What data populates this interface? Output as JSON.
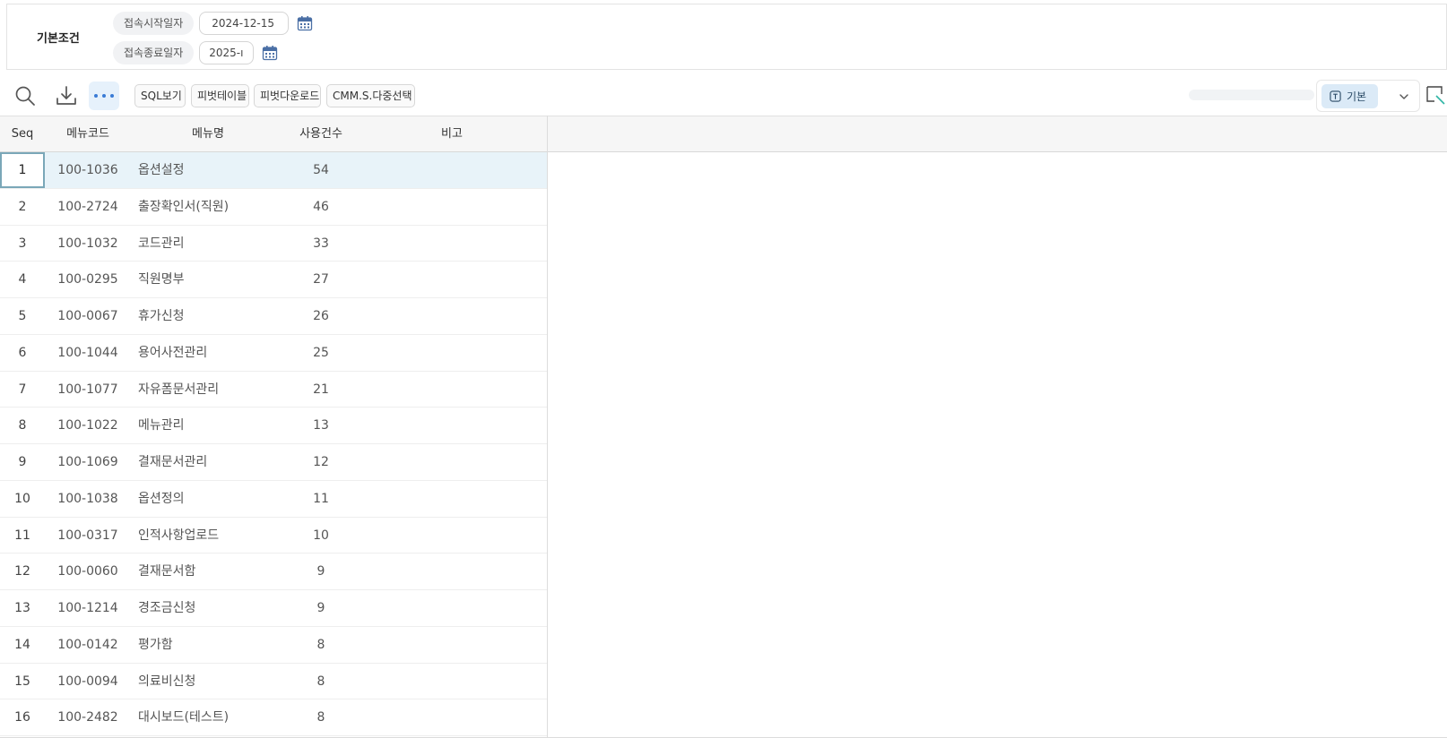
{
  "conditions": {
    "title": "기본조건",
    "start": {
      "label": "접속시작일자",
      "value": "2024-12-15"
    },
    "end": {
      "label": "접속종료일자",
      "value": "2025-ı"
    }
  },
  "toolbar": {
    "icons": [
      "search-icon",
      "download-icon",
      "more-icon"
    ],
    "buttons": [
      "SQL보기",
      "피벗테이블",
      "피벗다운로드",
      "CMM.S.다중선택"
    ],
    "view_label": "기본"
  },
  "grid": {
    "columns": [
      "Seq",
      "메뉴코드",
      "메뉴명",
      "사용건수",
      "비고"
    ],
    "selected_row": 0,
    "rows": [
      {
        "seq": "1",
        "code": "100-1036",
        "name": "옵션설정",
        "count": "54",
        "note": ""
      },
      {
        "seq": "2",
        "code": "100-2724",
        "name": "출장확인서(직원)",
        "count": "46",
        "note": ""
      },
      {
        "seq": "3",
        "code": "100-1032",
        "name": "코드관리",
        "count": "33",
        "note": ""
      },
      {
        "seq": "4",
        "code": "100-0295",
        "name": "직원명부",
        "count": "27",
        "note": ""
      },
      {
        "seq": "5",
        "code": "100-0067",
        "name": "휴가신청",
        "count": "26",
        "note": ""
      },
      {
        "seq": "6",
        "code": "100-1044",
        "name": "용어사전관리",
        "count": "25",
        "note": ""
      },
      {
        "seq": "7",
        "code": "100-1077",
        "name": "자유폼문서관리",
        "count": "21",
        "note": ""
      },
      {
        "seq": "8",
        "code": "100-1022",
        "name": "메뉴관리",
        "count": "13",
        "note": ""
      },
      {
        "seq": "9",
        "code": "100-1069",
        "name": "결재문서관리",
        "count": "12",
        "note": ""
      },
      {
        "seq": "10",
        "code": "100-1038",
        "name": "옵션정의",
        "count": "11",
        "note": ""
      },
      {
        "seq": "11",
        "code": "100-0317",
        "name": "인적사항업로드",
        "count": "10",
        "note": ""
      },
      {
        "seq": "12",
        "code": "100-0060",
        "name": "결재문서함",
        "count": "9",
        "note": ""
      },
      {
        "seq": "13",
        "code": "100-1214",
        "name": "경조금신청",
        "count": "9",
        "note": ""
      },
      {
        "seq": "14",
        "code": "100-0142",
        "name": "평가함",
        "count": "8",
        "note": ""
      },
      {
        "seq": "15",
        "code": "100-0094",
        "name": "의료비신청",
        "count": "8",
        "note": ""
      },
      {
        "seq": "16",
        "code": "100-2482",
        "name": "대시보드(테스트)",
        "count": "8",
        "note": ""
      }
    ]
  },
  "colors": {
    "selected_row_bg": "#e8f3f9",
    "active_chip_bg": "#dbeaf7",
    "calendar_icon": "#4a6fa5"
  }
}
